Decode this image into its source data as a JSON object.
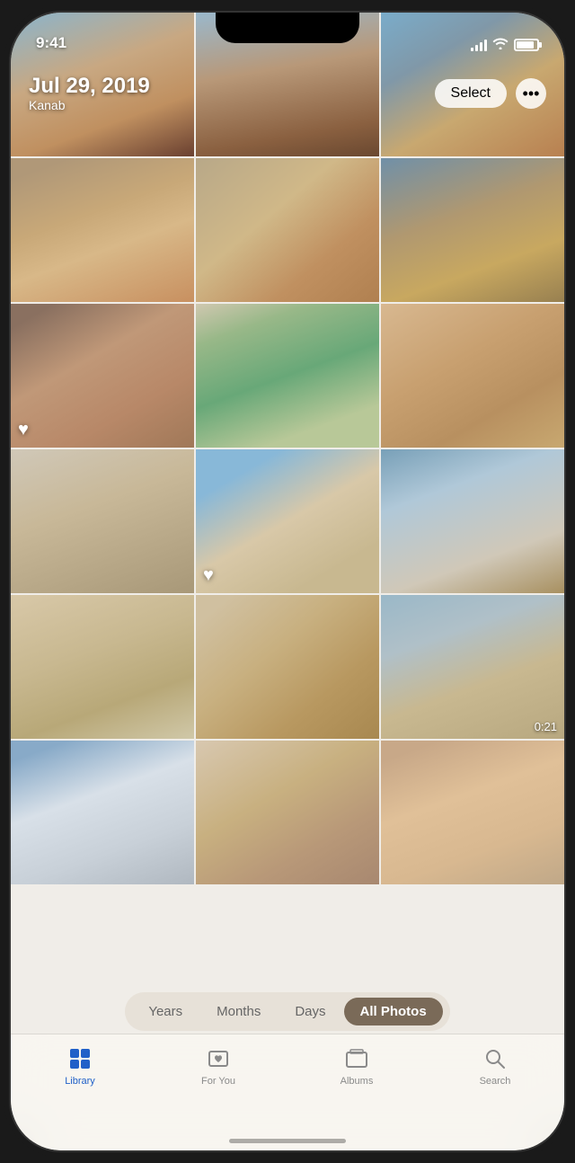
{
  "statusBar": {
    "time": "9:41",
    "batteryLevel": 85
  },
  "header": {
    "date": "Jul 29, 2019",
    "location": "Kanab",
    "selectLabel": "Select",
    "moreLabel": "•••"
  },
  "filterBar": {
    "items": [
      "Years",
      "Months",
      "Days",
      "All Photos"
    ],
    "activeItem": "All Photos"
  },
  "tabBar": {
    "items": [
      {
        "id": "library",
        "label": "Library",
        "active": true
      },
      {
        "id": "for-you",
        "label": "For You",
        "active": false
      },
      {
        "id": "albums",
        "label": "Albums",
        "active": false
      },
      {
        "id": "search",
        "label": "Search",
        "active": false
      }
    ]
  },
  "photos": [
    {
      "id": 1,
      "colorClass": "p1",
      "hasHeart": false,
      "videoTime": null
    },
    {
      "id": 2,
      "colorClass": "p2",
      "hasHeart": false,
      "videoTime": null
    },
    {
      "id": 3,
      "colorClass": "p3",
      "hasHeart": false,
      "videoTime": null
    },
    {
      "id": 4,
      "colorClass": "p4",
      "hasHeart": false,
      "videoTime": null
    },
    {
      "id": 5,
      "colorClass": "p5",
      "hasHeart": false,
      "videoTime": null
    },
    {
      "id": 6,
      "colorClass": "p6",
      "hasHeart": false,
      "videoTime": null
    },
    {
      "id": 7,
      "colorClass": "p7",
      "hasHeart": true,
      "videoTime": null
    },
    {
      "id": 8,
      "colorClass": "p8",
      "hasHeart": false,
      "videoTime": null
    },
    {
      "id": 9,
      "colorClass": "p9",
      "hasHeart": false,
      "videoTime": null
    },
    {
      "id": 10,
      "colorClass": "p10",
      "hasHeart": false,
      "videoTime": null
    },
    {
      "id": 11,
      "colorClass": "p11",
      "hasHeart": true,
      "videoTime": null
    },
    {
      "id": 12,
      "colorClass": "p12",
      "hasHeart": false,
      "videoTime": null
    },
    {
      "id": 13,
      "colorClass": "p13",
      "hasHeart": false,
      "videoTime": null
    },
    {
      "id": 14,
      "colorClass": "p14",
      "hasHeart": false,
      "videoTime": null
    },
    {
      "id": 15,
      "colorClass": "p15",
      "hasHeart": false,
      "videoTime": "0:21"
    },
    {
      "id": 16,
      "colorClass": "p16",
      "hasHeart": false,
      "videoTime": null
    },
    {
      "id": 17,
      "colorClass": "p17",
      "hasHeart": false,
      "videoTime": null
    },
    {
      "id": 18,
      "colorClass": "p18",
      "hasHeart": false,
      "videoTime": null
    }
  ]
}
